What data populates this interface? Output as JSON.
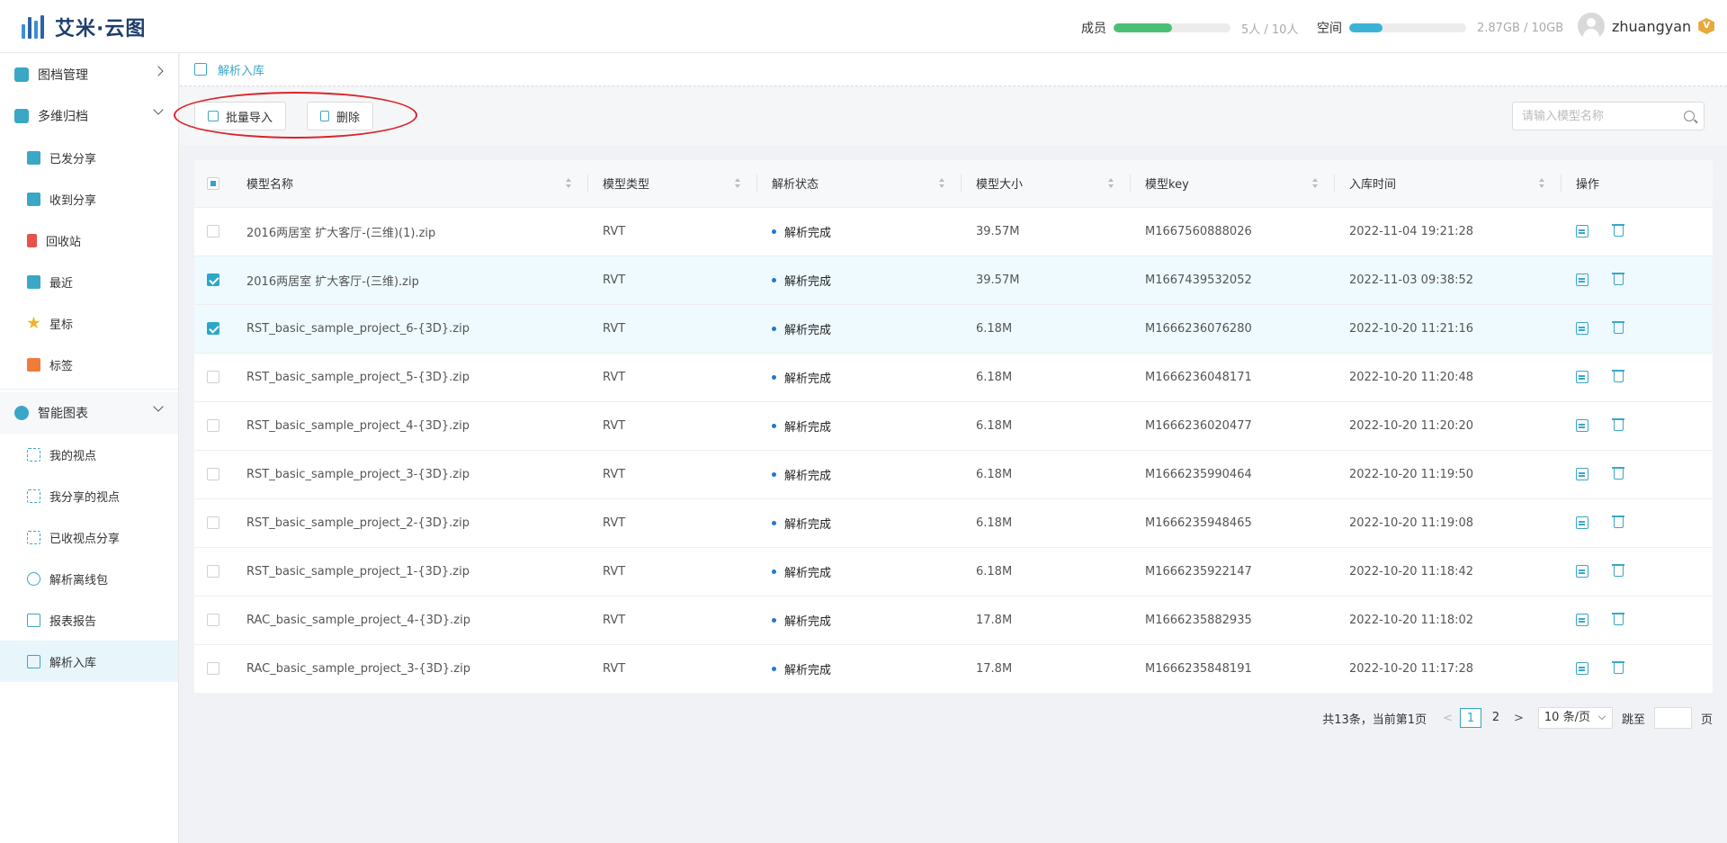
{
  "app": {
    "title": "艾米·云图"
  },
  "header": {
    "members": {
      "label": "成员",
      "value": "5人 / 10人",
      "ratio": 0.5
    },
    "space": {
      "label": "空间",
      "value": "2.87GB / 10GB",
      "ratio": 0.287
    },
    "username": "zhuangyan",
    "vip_badge": "V"
  },
  "sidebar": {
    "groups": [
      {
        "label": "图档管理",
        "icon": "archive-icon",
        "icon_color": "#3aa7c6"
      },
      {
        "label": "多维归档",
        "icon": "multi-archive-icon",
        "icon_color": "#3aa7c6"
      },
      {
        "label": "智能图表",
        "icon": "smart-chart-icon",
        "icon_color": "#3aa7c6"
      }
    ],
    "archive_items": [
      {
        "label": "已发分享",
        "icon": "shared-sent-icon",
        "icon_color": "#3aa7c6"
      },
      {
        "label": "收到分享",
        "icon": "shared-received-icon",
        "icon_color": "#3aa7c6"
      },
      {
        "label": "回收站",
        "icon": "recycle-bin-icon",
        "icon_color": "#e5534b"
      },
      {
        "label": "最近",
        "icon": "recent-icon",
        "icon_color": "#3aa7c6"
      },
      {
        "label": "星标",
        "icon": "star-icon",
        "icon_color": "#f0b429"
      },
      {
        "label": "标签",
        "icon": "tag-icon",
        "icon_color": "#f07c3a"
      }
    ],
    "chart_items": [
      {
        "label": "我的视点",
        "icon": "viewpoint-icon"
      },
      {
        "label": "我分享的视点",
        "icon": "shared-viewpoint-icon"
      },
      {
        "label": "已收视点分享",
        "icon": "received-viewpoint-icon"
      },
      {
        "label": "解析离线包",
        "icon": "offline-package-icon"
      },
      {
        "label": "报表报告",
        "icon": "report-icon"
      },
      {
        "label": "解析入库",
        "icon": "parse-import-icon"
      }
    ]
  },
  "breadcrumb": {
    "current": "解析入库"
  },
  "toolbar": {
    "import_label": "批量导入",
    "delete_label": "删除",
    "search_placeholder": "请输入模型名称"
  },
  "table": {
    "columns": [
      "模型名称",
      "模型类型",
      "解析状态",
      "模型大小",
      "模型key",
      "入库时间",
      "操作"
    ],
    "rows": [
      {
        "name": "2016两居室 扩大客厅-(三维)(1).zip",
        "type": "RVT",
        "status": "解析完成",
        "size": "39.57M",
        "key": "M1667560888026",
        "time": "2022-11-04 19:21:28",
        "selected": false
      },
      {
        "name": "2016两居室 扩大客厅-(三维).zip",
        "type": "RVT",
        "status": "解析完成",
        "size": "39.57M",
        "key": "M1667439532052",
        "time": "2022-11-03 09:38:52",
        "selected": true
      },
      {
        "name": "RST_basic_sample_project_6-{3D}.zip",
        "type": "RVT",
        "status": "解析完成",
        "size": "6.18M",
        "key": "M1666236076280",
        "time": "2022-10-20 11:21:16",
        "selected": true
      },
      {
        "name": "RST_basic_sample_project_5-{3D}.zip",
        "type": "RVT",
        "status": "解析完成",
        "size": "6.18M",
        "key": "M1666236048171",
        "time": "2022-10-20 11:20:48",
        "selected": false
      },
      {
        "name": "RST_basic_sample_project_4-{3D}.zip",
        "type": "RVT",
        "status": "解析完成",
        "size": "6.18M",
        "key": "M1666236020477",
        "time": "2022-10-20 11:20:20",
        "selected": false
      },
      {
        "name": "RST_basic_sample_project_3-{3D}.zip",
        "type": "RVT",
        "status": "解析完成",
        "size": "6.18M",
        "key": "M1666235990464",
        "time": "2022-10-20 11:19:50",
        "selected": false
      },
      {
        "name": "RST_basic_sample_project_2-{3D}.zip",
        "type": "RVT",
        "status": "解析完成",
        "size": "6.18M",
        "key": "M1666235948465",
        "time": "2022-10-20 11:19:08",
        "selected": false
      },
      {
        "name": "RST_basic_sample_project_1-{3D}.zip",
        "type": "RVT",
        "status": "解析完成",
        "size": "6.18M",
        "key": "M1666235922147",
        "time": "2022-10-20 11:18:42",
        "selected": false
      },
      {
        "name": "RAC_basic_sample_project_4-{3D}.zip",
        "type": "RVT",
        "status": "解析完成",
        "size": "17.8M",
        "key": "M1666235882935",
        "time": "2022-10-20 11:18:02",
        "selected": false
      },
      {
        "name": "RAC_basic_sample_project_3-{3D}.zip",
        "type": "RVT",
        "status": "解析完成",
        "size": "17.8M",
        "key": "M1666235848191",
        "time": "2022-10-20 11:17:28",
        "selected": false
      }
    ]
  },
  "pagination": {
    "summary": "共13条，当前第1页",
    "pages": [
      "1",
      "2"
    ],
    "current_page": "1",
    "page_size": "10 条/页",
    "jump_label": "跳至",
    "page_suffix": "页"
  },
  "colors": {
    "accent": "#2ea6c8",
    "annotation": "#d9252c",
    "members_bar": "#4bbf73",
    "space_bar": "#3ab3d5"
  }
}
